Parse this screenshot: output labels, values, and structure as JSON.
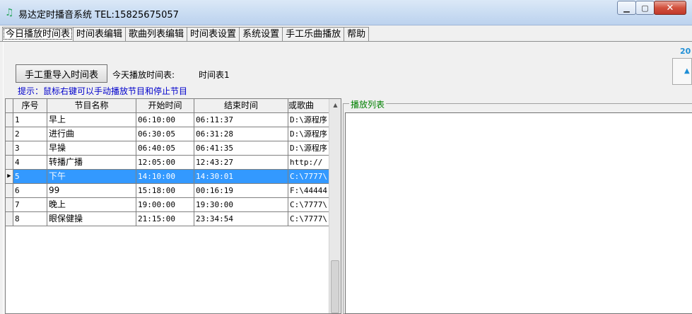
{
  "window": {
    "title": "易达定时播音系统  TEL:15825675057",
    "icon": "speaker-icon",
    "minimize": "▁",
    "maximize": "▢",
    "close": "✕"
  },
  "tabs": [
    {
      "label": "今日播放时间表",
      "active": true
    },
    {
      "label": "时间表编辑"
    },
    {
      "label": "歌曲列表编辑"
    },
    {
      "label": "时间表设置"
    },
    {
      "label": "系统设置"
    },
    {
      "label": "手工乐曲播放"
    },
    {
      "label": "帮助"
    }
  ],
  "toolbar": {
    "reimport_label": "手工重导入时间表",
    "today_label": "今天播放时间表:",
    "today_value": "时间表1",
    "hint": "提示：鼠标右键可以手动播放节目和停止节目"
  },
  "corner": {
    "number": "20"
  },
  "grid": {
    "headers": [
      "序号",
      "节目名称",
      "开始时间",
      "结束时间",
      "或歌曲"
    ],
    "rows": [
      [
        "1",
        "早上",
        "06:10:00",
        "06:11:37",
        "D:\\源程序"
      ],
      [
        "2",
        "进行曲",
        "06:30:05",
        "06:31:28",
        "D:\\源程序"
      ],
      [
        "3",
        "早操",
        "06:40:05",
        "06:41:35",
        "D:\\源程序"
      ],
      [
        "4",
        "转播广播",
        "12:05:00",
        "12:43:27",
        "http://"
      ],
      [
        "5",
        "下午",
        "14:10:00",
        "14:30:01",
        "C:\\7777\\"
      ],
      [
        "6",
        "99",
        "15:18:00",
        "00:16:19",
        "F:\\44444"
      ],
      [
        "7",
        "晚上",
        "19:00:00",
        "19:30:00",
        "C:\\7777\\"
      ],
      [
        "8",
        "眼保健操",
        "21:15:00",
        "23:34:54",
        "C:\\7777\\"
      ]
    ],
    "selected_index": 4,
    "row_pointer": "▶"
  },
  "playlist": {
    "title": "播放列表"
  },
  "colors": {
    "selection": "#3399ff",
    "hint": "#0000cc",
    "playlist_title": "#008000"
  }
}
